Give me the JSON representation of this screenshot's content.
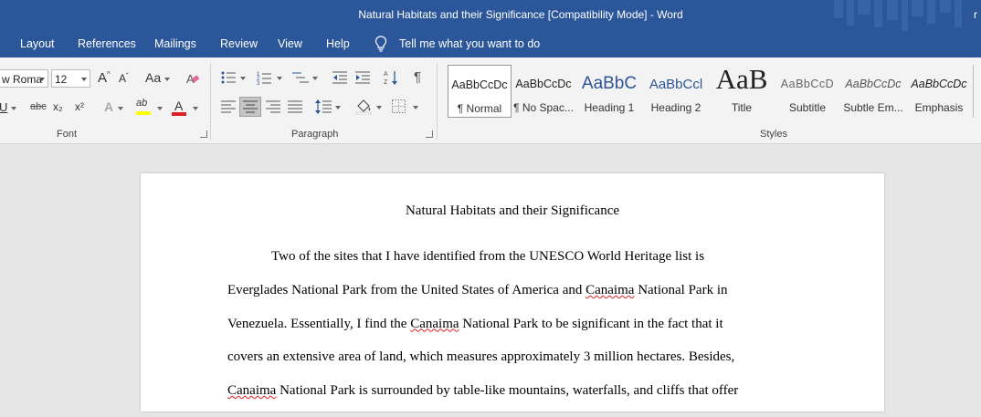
{
  "window": {
    "title": "Natural Habitats and their Significance [Compatibility Mode]  -  Word",
    "user_initial": "r"
  },
  "tabs": [
    "Layout",
    "References",
    "Mailings",
    "Review",
    "View",
    "Help"
  ],
  "tell_me": "Tell me what you want to do",
  "font": {
    "name": "w Roma",
    "size": "12",
    "grow_label": "A",
    "shrink_label": "A",
    "change_case_label": "Aa",
    "strike_label": "abc",
    "subscript_label": "x₂",
    "superscript_label": "x²",
    "underline_label": "U",
    "effects_label": "A",
    "highlight_label": "ab",
    "font_color_label": "A",
    "group_label": "Font"
  },
  "paragraph": {
    "group_label": "Paragraph"
  },
  "styles": {
    "group_label": "Styles",
    "items": [
      {
        "preview": "AaBbCcDc",
        "label": "¶ Normal"
      },
      {
        "preview": "AaBbCcDc",
        "label": "¶ No Spac..."
      },
      {
        "preview": "AaBbC",
        "label": "Heading 1"
      },
      {
        "preview": "AaBbCcl",
        "label": "Heading 2"
      },
      {
        "preview": "AaB",
        "label": "Title"
      },
      {
        "preview": "AaBbCcD",
        "label": "Subtitle"
      },
      {
        "preview": "AaBbCcDc",
        "label": "Subtle Em..."
      },
      {
        "preview": "AaBbCcDc",
        "label": "Emphasis"
      }
    ]
  },
  "colors": {
    "accent": "#2b579a",
    "highlight": "#ffff00",
    "font_color": "#e02020",
    "heading": "#2f5496"
  },
  "document": {
    "title": "Natural Habitats and their Significance",
    "l1": "Two of the sites that I have identified from the UNESCO World Heritage list is",
    "l2a": "Everglades National Park from the United States of America and ",
    "l2b": "Canaima",
    "l2c": " National Park in",
    "l3a": "Venezuela. Essentially, I find the ",
    "l3b": "Canaima",
    "l3c": " National Park to be significant in the fact that it",
    "l4": "covers an extensive area of land, which measures approximately 3 million hectares. Besides,",
    "l5a": "Canaima",
    "l5b": " National Park is surrounded by table-like mountains, waterfalls, and cliffs that offer"
  }
}
